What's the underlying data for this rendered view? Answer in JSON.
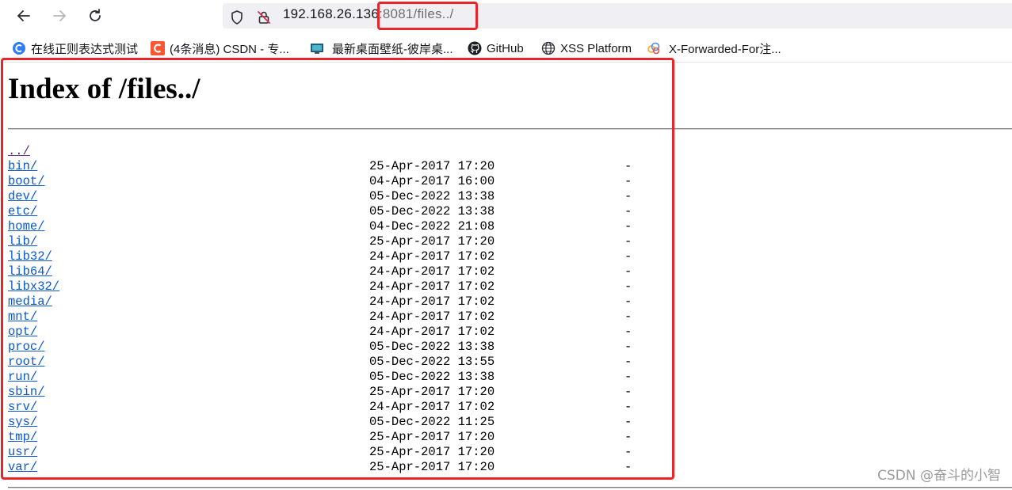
{
  "browser": {
    "url_host": "192.168.26.136",
    "url_path": ":8081/files../",
    "icons": [
      "back-icon",
      "forward-icon",
      "reload-icon",
      "shield-icon",
      "insecure-lock-icon"
    ]
  },
  "bookmarks": [
    {
      "label": "在线正则表达式测试",
      "icon": "regex-site-icon"
    },
    {
      "label": "(4条消息) CSDN - 专...",
      "icon": "csdn-icon"
    },
    {
      "label": "最新桌面壁纸-彼岸桌...",
      "icon": "wallpaper-site-icon"
    },
    {
      "label": "GitHub",
      "icon": "github-icon"
    },
    {
      "label": "XSS Platform",
      "icon": "globe-icon"
    },
    {
      "label": "X-Forwarded-For注...",
      "icon": "cloud-site-icon"
    }
  ],
  "page": {
    "title": "Index of /files../",
    "parent_link": "../",
    "entries": [
      {
        "name": "bin/",
        "date": "25-Apr-2017 17:20",
        "size": "-"
      },
      {
        "name": "boot/",
        "date": "04-Apr-2017 16:00",
        "size": "-"
      },
      {
        "name": "dev/",
        "date": "05-Dec-2022 13:38",
        "size": "-"
      },
      {
        "name": "etc/",
        "date": "05-Dec-2022 13:38",
        "size": "-"
      },
      {
        "name": "home/",
        "date": "04-Dec-2022 21:08",
        "size": "-"
      },
      {
        "name": "lib/",
        "date": "25-Apr-2017 17:20",
        "size": "-"
      },
      {
        "name": "lib32/",
        "date": "24-Apr-2017 17:02",
        "size": "-"
      },
      {
        "name": "lib64/",
        "date": "24-Apr-2017 17:02",
        "size": "-"
      },
      {
        "name": "libx32/",
        "date": "24-Apr-2017 17:02",
        "size": "-"
      },
      {
        "name": "media/",
        "date": "24-Apr-2017 17:02",
        "size": "-"
      },
      {
        "name": "mnt/",
        "date": "24-Apr-2017 17:02",
        "size": "-"
      },
      {
        "name": "opt/",
        "date": "24-Apr-2017 17:02",
        "size": "-"
      },
      {
        "name": "proc/",
        "date": "05-Dec-2022 13:38",
        "size": "-"
      },
      {
        "name": "root/",
        "date": "05-Dec-2022 13:55",
        "size": "-"
      },
      {
        "name": "run/",
        "date": "05-Dec-2022 13:38",
        "size": "-"
      },
      {
        "name": "sbin/",
        "date": "25-Apr-2017 17:20",
        "size": "-"
      },
      {
        "name": "srv/",
        "date": "24-Apr-2017 17:02",
        "size": "-"
      },
      {
        "name": "sys/",
        "date": "05-Dec-2022 11:25",
        "size": "-"
      },
      {
        "name": "tmp/",
        "date": "25-Apr-2017 17:20",
        "size": "-"
      },
      {
        "name": "usr/",
        "date": "25-Apr-2017 17:20",
        "size": "-"
      },
      {
        "name": "var/",
        "date": "25-Apr-2017 17:20",
        "size": "-"
      }
    ]
  },
  "annotation": {
    "color": "#e8262a"
  },
  "watermark": "CSDN @奋斗的小智"
}
